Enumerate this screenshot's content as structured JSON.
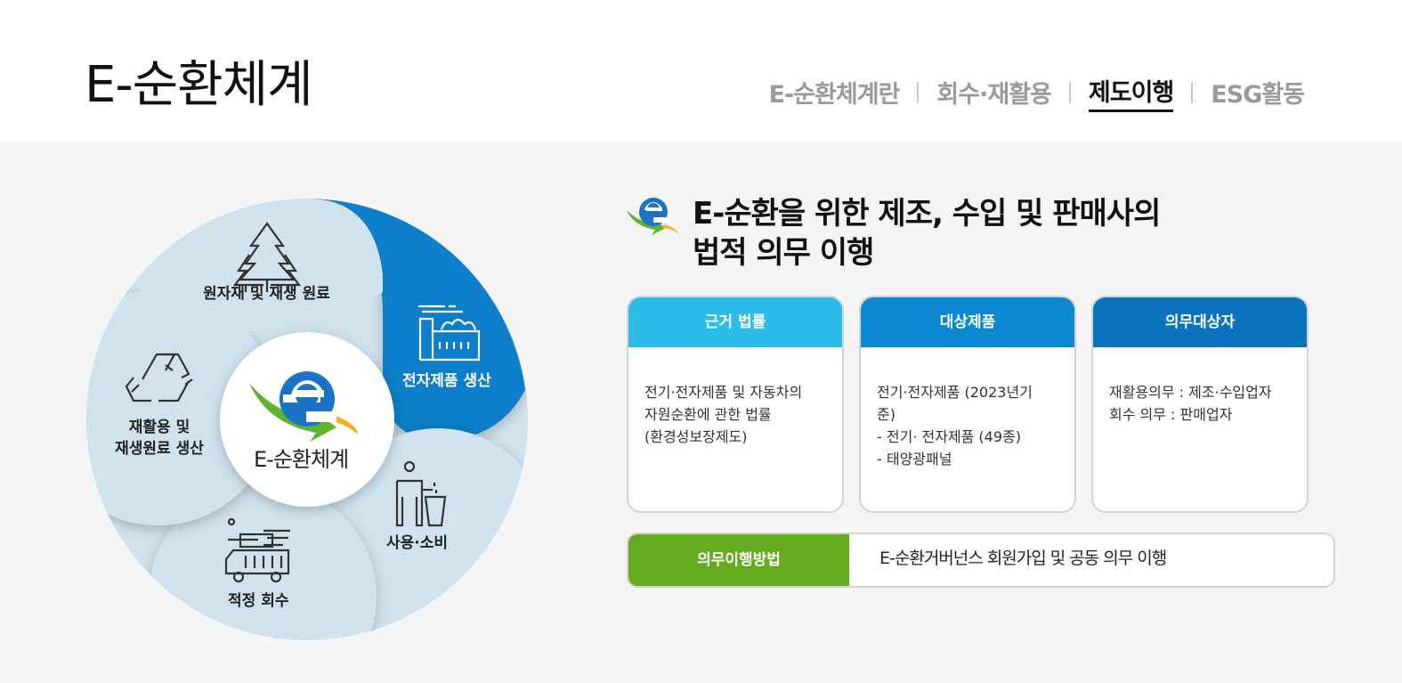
{
  "page_title": "E-순환체계",
  "tabs": [
    {
      "label": "E-순환체계란",
      "active": false
    },
    {
      "label": "회수·재활용",
      "active": false
    },
    {
      "label": "제도이행",
      "active": true
    },
    {
      "label": "ESG활동",
      "active": false
    }
  ],
  "cycle": {
    "center_label": "E-순환체계",
    "segments": [
      {
        "label": "원자재 및 재생 원료",
        "icon": "trees-icon"
      },
      {
        "label": "전자제품 생산",
        "icon": "factory-icon"
      },
      {
        "label": "사용·소비",
        "icon": "person-disposing-icon"
      },
      {
        "label": "적정 회수",
        "icon": "collection-truck-icon"
      },
      {
        "label_line1": "재활용 및",
        "label_line2": "재생원료 생산",
        "icon": "recycle-icon"
      }
    ]
  },
  "heading": {
    "line1": "E-순환을 위한 제조, 수입 및 판매사의",
    "line2": "법적 의무 이행"
  },
  "cards": [
    {
      "title": "근거 법률",
      "color": "#2bbde8",
      "lines": [
        "전기·전자제품 및 자동차의",
        "자원순환에 관한 법률",
        "(환경성보장제도)"
      ]
    },
    {
      "title": "대상제품",
      "color": "#0a89d0",
      "lines": [
        "전기·전자제품 (2023년기",
        "준)",
        "- 전기· 전자제품 (49종)",
        "- 태양광패널"
      ]
    },
    {
      "title": "의무대상자",
      "color": "#0a73be",
      "lines": [
        "재활용의무 : 제조·수입업자",
        "회수 의무 : 판매업자"
      ]
    }
  ],
  "method": {
    "label": "의무이행방법",
    "text": "E-순환거버넌스 회원가입 및 공동 의무 이행"
  },
  "colors": {
    "green": "#65ab1f",
    "light_blue": "#2bbde8",
    "blue": "#0a89d0",
    "dark_blue": "#0a73be",
    "cycle_bg": "#cfe2ee",
    "cycle_active": "#0a7ec9"
  }
}
